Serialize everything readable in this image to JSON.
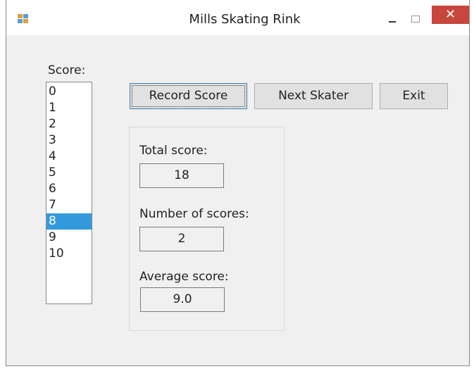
{
  "window": {
    "title": "Mills Skating Rink",
    "close_glyph": "✕"
  },
  "score": {
    "label": "Score:",
    "items": [
      "0",
      "1",
      "2",
      "3",
      "4",
      "5",
      "6",
      "7",
      "8",
      "9",
      "10"
    ],
    "selected": "8"
  },
  "buttons": {
    "record": "Record Score",
    "next": "Next Skater",
    "exit": "Exit"
  },
  "totals": {
    "total_label": "Total score:",
    "total_value": "18",
    "count_label": "Number of scores:",
    "count_value": "2",
    "average_label": "Average score:",
    "average_value": "9.0"
  },
  "colors": {
    "accent_selection": "#3399dd",
    "close_button": "#c7463d"
  }
}
